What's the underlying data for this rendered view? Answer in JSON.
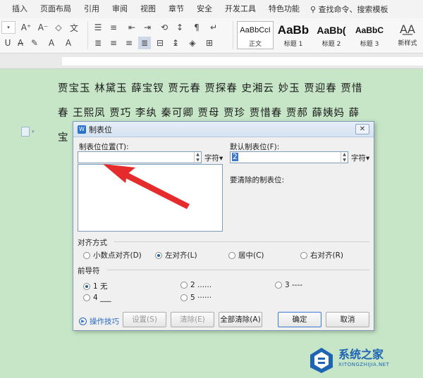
{
  "ribbon": {
    "menus": [
      "插入",
      "页面布局",
      "引用",
      "审阅",
      "视图",
      "章节",
      "安全",
      "开发工具",
      "特色功能"
    ],
    "search_label": "查找命令、搜索模板",
    "styles": [
      {
        "sample": "AaBbCcI",
        "name": "正文"
      },
      {
        "sample": "AaBb",
        "name": "标题 1"
      },
      {
        "sample": "AaBb(",
        "name": "标题 2"
      },
      {
        "sample": "AaBbC",
        "name": "标题 3"
      }
    ],
    "new_style_label": "新样式"
  },
  "document": {
    "lines": [
      "贾宝玉  林黛玉  薛宝钗  贾元春  贾探春  史湘云  妙玉  贾迎春  贾惜",
      "春  王熙凤  贾巧  李纨  秦可卿  贾母  贾珍  贾惜春  贾郝  薛姨妈  薛",
      "宝"
    ]
  },
  "dialog": {
    "title": "制表位",
    "close_glyph": "✕",
    "tab_position_label": "制表位位置(T):",
    "tab_position_value": "",
    "tab_unit": "字符▾",
    "default_tab_label": "默认制表位(F):",
    "default_tab_value": "2",
    "default_unit": "字符▾",
    "to_clear_label": "要清除的制表位:",
    "alignment": {
      "title": "对齐方式",
      "options": [
        "小数点对齐(D)",
        "左对齐(L)",
        "居中(C)",
        "右对齐(R)"
      ],
      "selected": 1
    },
    "leader": {
      "title": "前导符",
      "options": [
        "1 无",
        "2 ......",
        "3 ----",
        "4 ___",
        "5 ······"
      ],
      "selected": 0
    },
    "tips_label": "操作技巧",
    "buttons": {
      "set": "设置(S)",
      "clear": "清除(E)",
      "clear_all": "全部清除(A)",
      "ok": "确定",
      "cancel": "取消"
    }
  },
  "watermark": {
    "name": "系统之家",
    "url": "XITONGZHIJIA.NET"
  },
  "colors": {
    "background": "#c7e6c7",
    "accent": "#2b72c9",
    "arrow": "#e52b2b"
  }
}
